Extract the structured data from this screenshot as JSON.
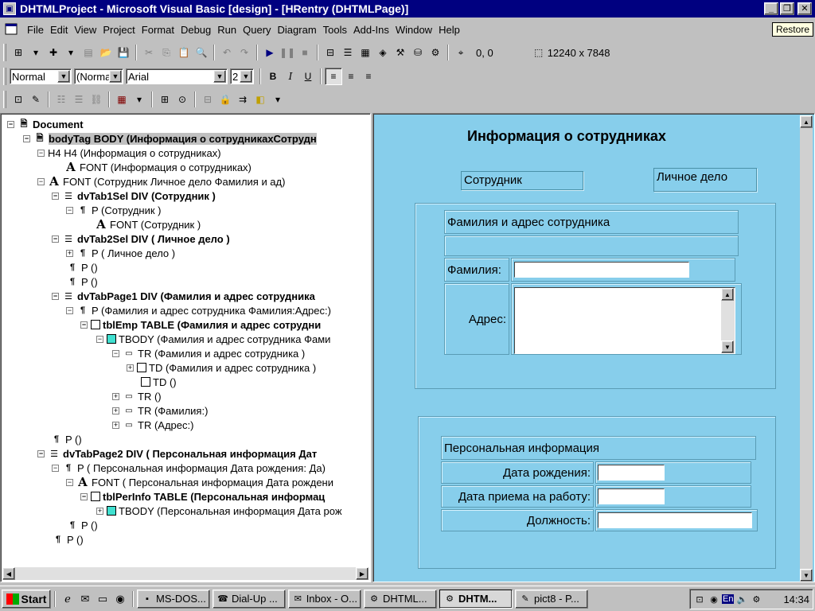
{
  "window": {
    "title": "DHTMLProject - Microsoft Visual Basic [design] - [HRentry (DHTMLPage)]"
  },
  "menu": [
    "File",
    "Edit",
    "View",
    "Project",
    "Format",
    "Debug",
    "Run",
    "Query",
    "Diagram",
    "Tools",
    "Add-Ins",
    "Window",
    "Help"
  ],
  "tooltip": "Restore",
  "toolbar": {
    "position": "0, 0",
    "size": "12240 x 7848",
    "style_combo": "Normal",
    "para_combo": "(Norma",
    "font_combo": "Arial",
    "size_combo": "2"
  },
  "outline": {
    "nodes": [
      {
        "label": "Document",
        "bold": true
      },
      {
        "label": "bodyTag BODY (Информация о сотрудникахСотрудн",
        "bold": true
      },
      {
        "label": "H4 H4 (Информация о сотрудниках)"
      },
      {
        "label": "FONT (Информация о сотрудниках)"
      },
      {
        "label": "FONT (Сотрудник Личное дело Фамилия и ад)"
      },
      {
        "label": "dvTab1Sel DIV (Сотрудник )",
        "bold": true
      },
      {
        "label": "P (Сотрудник )"
      },
      {
        "label": "FONT (Сотрудник )"
      },
      {
        "label": "dvTab2Sel DIV ( Личное дело )",
        "bold": true
      },
      {
        "label": "P ( Личное дело )"
      },
      {
        "label": "P ()"
      },
      {
        "label": "P ()"
      },
      {
        "label": "dvTabPage1 DIV (Фамилия и адрес сотрудника",
        "bold": true
      },
      {
        "label": "P (Фамилия и адрес сотрудника  Фамилия:Адрес:)"
      },
      {
        "label": "tblEmp TABLE (Фамилия и адрес сотрудни",
        "bold": true
      },
      {
        "label": "TBODY (Фамилия и адрес сотрудника  Фами"
      },
      {
        "label": "TR (Фамилия и адрес сотрудника )"
      },
      {
        "label": "TD (Фамилия и адрес сотрудника )"
      },
      {
        "label": "TD ()"
      },
      {
        "label": "TR ()"
      },
      {
        "label": "TR (Фамилия:)"
      },
      {
        "label": "TR (Адрес:)"
      },
      {
        "label": "P ()"
      },
      {
        "label": "dvTabPage2 DIV ( Персональная информация Дат",
        "bold": true
      },
      {
        "label": "P ( Персональная информация Дата рождения: Да)"
      },
      {
        "label": "FONT ( Персональная информация Дата рождени"
      },
      {
        "label": "tblPerInfo TABLE (Персональная информац",
        "bold": true
      },
      {
        "label": "TBODY (Персональная информация Дата рож"
      },
      {
        "label": "P ()"
      },
      {
        "label": "P ()"
      }
    ]
  },
  "design": {
    "heading": "Информация о сотрудниках",
    "tab1": "Сотрудник",
    "tab2": "Личное дело",
    "emp_header": "Фамилия и адрес сотрудника",
    "lastname_label": "Фамилия:",
    "address_label": "Адрес:",
    "personal_header": "Персональная информация",
    "birth_label": "Дата рождения:",
    "hire_label": "Дата приема на работу:",
    "position_label": "Должность:"
  },
  "taskbar": {
    "start": "Start",
    "buttons": [
      "MS-DOS...",
      "Dial-Up ...",
      "Inbox - O...",
      "DHTML...",
      "DHTM...",
      "pict8 - P..."
    ],
    "active_index": 4,
    "lang": "En",
    "clock": "14:34"
  }
}
